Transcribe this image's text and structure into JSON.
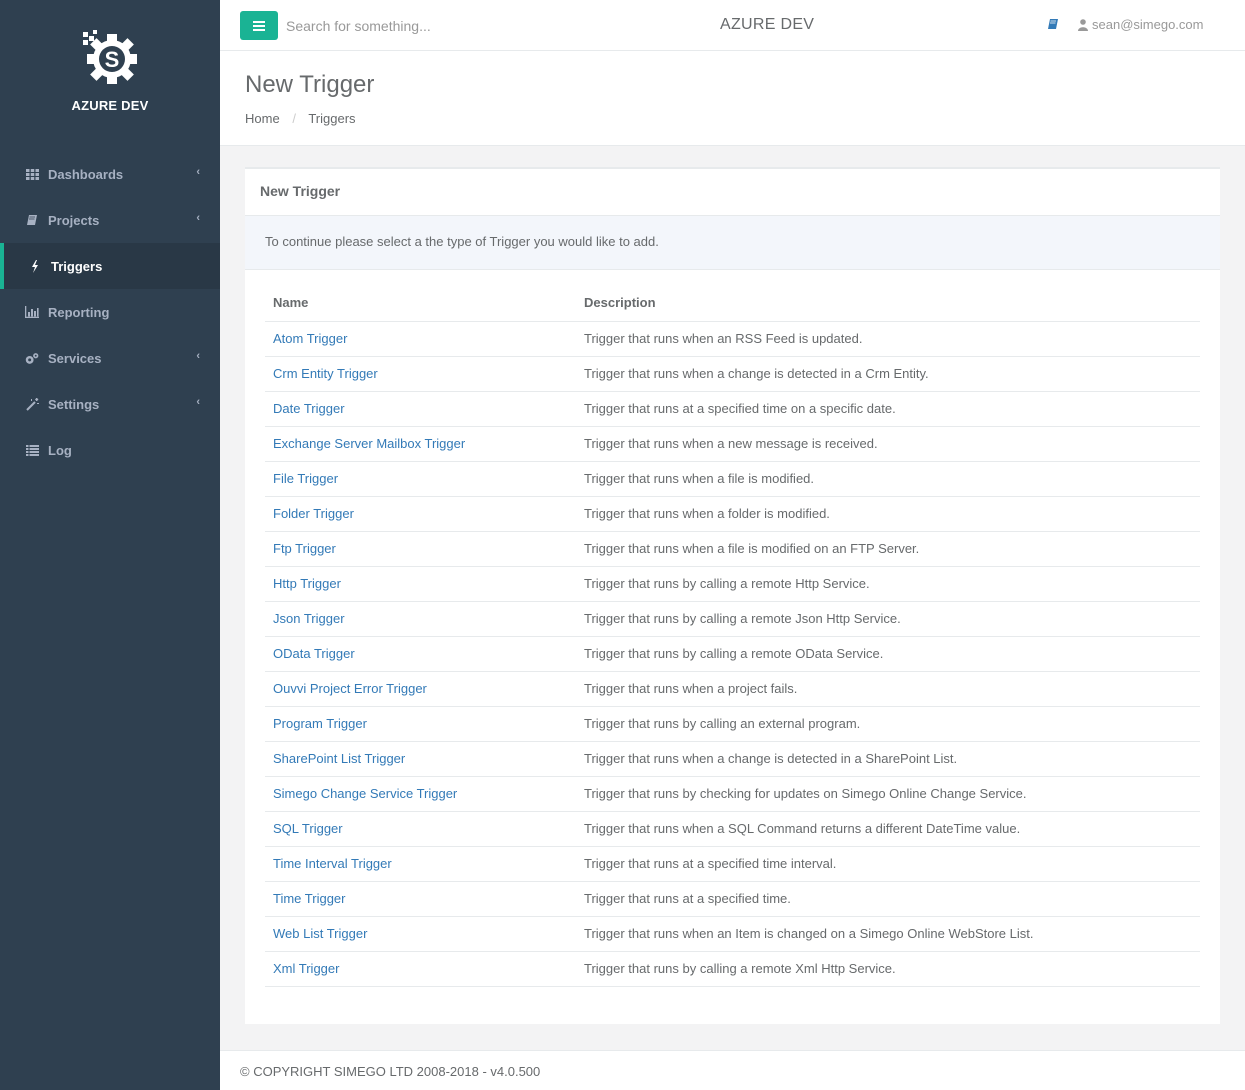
{
  "brand": {
    "name": "AZURE DEV"
  },
  "sidebar": {
    "items": [
      {
        "label": "Dashboards",
        "icon": "grid-icon",
        "arrow": true
      },
      {
        "label": "Projects",
        "icon": "book-icon",
        "arrow": true
      },
      {
        "label": "Triggers",
        "icon": "bolt-icon",
        "arrow": false,
        "active": true
      },
      {
        "label": "Reporting",
        "icon": "bar-chart-icon",
        "arrow": false
      },
      {
        "label": "Services",
        "icon": "cogs-icon",
        "arrow": true
      },
      {
        "label": "Settings",
        "icon": "magic-wand-icon",
        "arrow": true
      },
      {
        "label": "Log",
        "icon": "list-icon",
        "arrow": false
      }
    ],
    "arrow_glyph": "‹"
  },
  "topbar": {
    "search_placeholder": "Search for something...",
    "env_title": "AZURE DEV",
    "user": "sean@simego.com"
  },
  "heading": {
    "title": "New Trigger",
    "breadcrumb": [
      "Home",
      "Triggers"
    ],
    "breadcrumb_sep": "/"
  },
  "panel": {
    "title": "New Trigger",
    "info": "To continue please select a the type of Trigger you would like to add.",
    "columns": [
      "Name",
      "Description"
    ],
    "rows": [
      {
        "name": "Atom Trigger",
        "description": "Trigger that runs when an RSS Feed is updated."
      },
      {
        "name": "Crm Entity Trigger",
        "description": "Trigger that runs when a change is detected in a Crm Entity."
      },
      {
        "name": "Date Trigger",
        "description": "Trigger that runs at a specified time on a specific date."
      },
      {
        "name": "Exchange Server Mailbox Trigger",
        "description": "Trigger that runs when a new message is received."
      },
      {
        "name": "File Trigger",
        "description": "Trigger that runs when a file is modified."
      },
      {
        "name": "Folder Trigger",
        "description": "Trigger that runs when a folder is modified."
      },
      {
        "name": "Ftp Trigger",
        "description": "Trigger that runs when a file is modified on an FTP Server."
      },
      {
        "name": "Http Trigger",
        "description": "Trigger that runs by calling a remote Http Service."
      },
      {
        "name": "Json Trigger",
        "description": "Trigger that runs by calling a remote Json Http Service."
      },
      {
        "name": "OData Trigger",
        "description": "Trigger that runs by calling a remote OData Service."
      },
      {
        "name": "Ouvvi Project Error Trigger",
        "description": "Trigger that runs when a project fails."
      },
      {
        "name": "Program Trigger",
        "description": "Trigger that runs by calling an external program."
      },
      {
        "name": "SharePoint List Trigger",
        "description": "Trigger that runs when a change is detected in a SharePoint List."
      },
      {
        "name": "Simego Change Service Trigger",
        "description": "Trigger that runs by checking for updates on Simego Online Change Service."
      },
      {
        "name": "SQL Trigger",
        "description": "Trigger that runs when a SQL Command returns a different DateTime value."
      },
      {
        "name": "Time Interval Trigger",
        "description": "Trigger that runs at a specified time interval."
      },
      {
        "name": "Time Trigger",
        "description": "Trigger that runs at a specified time."
      },
      {
        "name": "Web List Trigger",
        "description": "Trigger that runs when an Item is changed on a Simego Online WebStore List."
      },
      {
        "name": "Xml Trigger",
        "description": "Trigger that runs by calling a remote Xml Http Service."
      }
    ]
  },
  "footer": {
    "text": "© COPYRIGHT SIMEGO LTD 2008-2018 - v4.0.500"
  },
  "colors": {
    "sidebar": "#2f4050",
    "accent": "#1ab394",
    "link": "#337ab7"
  }
}
